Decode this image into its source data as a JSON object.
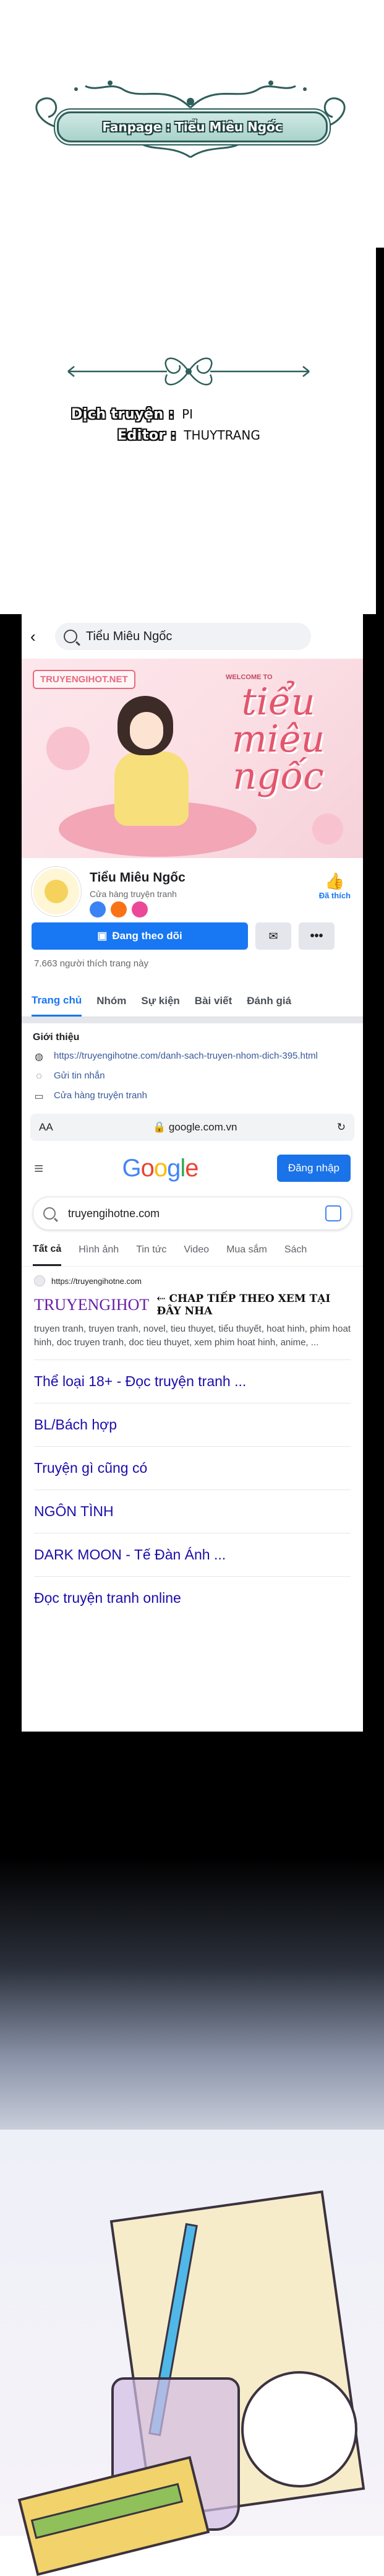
{
  "header": {
    "fanpage_banner": "Fanpage : Tiểu Miêu Ngốc"
  },
  "credits": {
    "translator_label": "Dịch truyện :",
    "translator_value": "PI",
    "editor_label": "Editor :",
    "editor_value": "THUYTRANG"
  },
  "facebook": {
    "search_text": "Tiểu Miêu Ngốc",
    "cover_site_label": "TRUYENGIHOT.NET",
    "cover_welcome": "WELCOME TO",
    "cover_title": "tiểu miêu ngốc",
    "page_name": "Tiểu Miêu Ngốc",
    "page_category": "Cửa hàng truyện tranh",
    "like_label": "Đã thích",
    "follow_button": "Đang theo dõi",
    "more_button": "•••",
    "likes_count": "7.663 người thích trang này",
    "tabs": [
      "Trang chủ",
      "Nhóm",
      "Sự kiện",
      "Bài viết",
      "Đánh giá"
    ],
    "intro_title": "Giới thiệu",
    "intro_items": [
      "https://truyengihotne.com/danh-sach-truyen-nhom-dich-395.html",
      "Gửi tin nhắn",
      "Cửa hàng truyện tranh"
    ],
    "colors": {
      "accent": "#1877f2"
    }
  },
  "browser": {
    "text_size": "AA",
    "url": "google.com.vn",
    "reload_icon": "↻"
  },
  "google": {
    "logo_letters": [
      "G",
      "o",
      "o",
      "g",
      "l",
      "e"
    ],
    "signin_button": "Đăng nhập",
    "query": "truyengihotne.com",
    "tabs": [
      "Tất cả",
      "Hình ảnh",
      "Tin tức",
      "Video",
      "Mua sắm",
      "Sách"
    ],
    "result_url": "https://truyengihotne.com",
    "result_title": "TRUYENGIHOT",
    "promo_text": "⇠ CHAP TIẾP THEO XEM TẠI ĐÂY NHA",
    "snippet": "truyen tranh, truyen tranh, novel, tieu thuyet, tiểu thuyết, hoat hinh, phim hoat hinh, doc truyen tranh, doc tieu thuyet, xem phim hoat hinh, anime, ...",
    "links": [
      "Thể loại 18+ - Đọc truyện tranh ...",
      "BL/Bách hợp",
      "Truyện gì cũng có",
      "NGÔN TÌNH",
      "DARK MOON - Tế Đàn Ánh ...",
      "Đọc truyện tranh online"
    ]
  }
}
